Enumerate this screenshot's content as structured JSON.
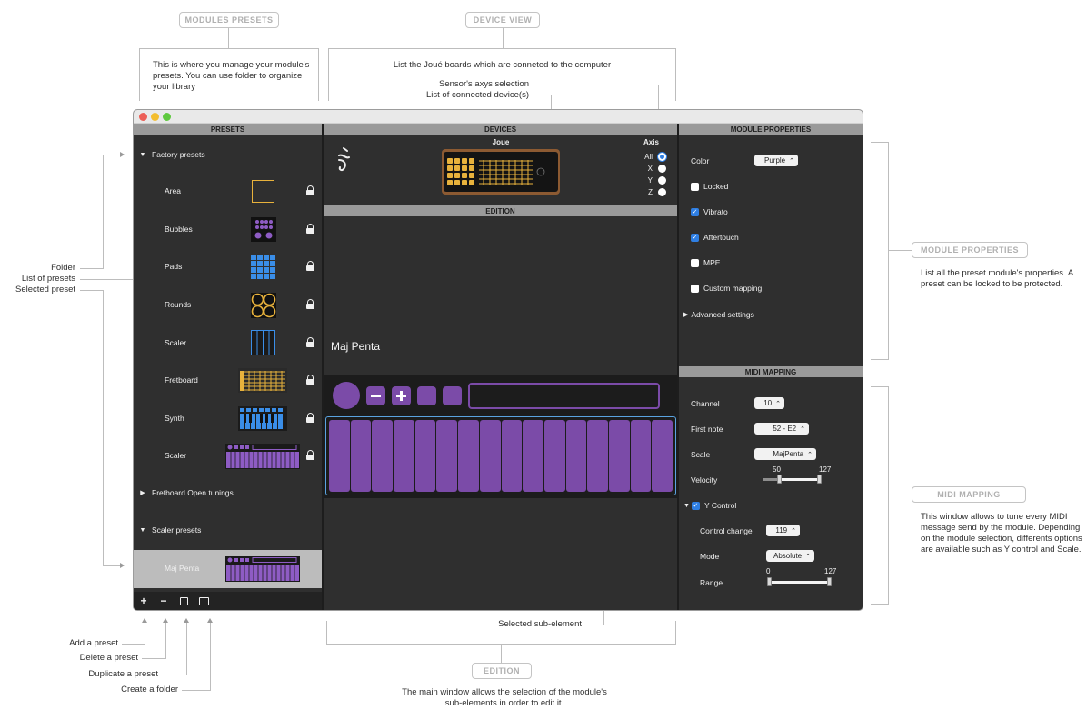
{
  "annotations": {
    "modules_presets": {
      "title": "MODULES PRESETS",
      "text": "This is where you manage your module's presets. You can use folder to organize your library"
    },
    "device_view": {
      "title": "DEVICE VIEW",
      "text": "List the Joué boards which are conneted to the computer",
      "sensor_axis": "Sensor's axys selection",
      "connected_devices": "List of connected device(s)"
    },
    "left": {
      "folder": "Folder",
      "list_of_presets": "List of presets",
      "selected_preset": "Selected preset"
    },
    "module_properties": {
      "title": "MODULE PROPERTIES",
      "text": "List all the preset module's properties. A preset can be locked to be protected."
    },
    "midi_mapping": {
      "title": "MIDI MAPPING",
      "text": "This window allows to tune every MIDI message send by the module. Depending on the module selection, differents options are available such as Y control and Scale."
    },
    "bottom": {
      "add_preset": "Add a preset",
      "delete_preset": "Delete a preset",
      "duplicate_preset": "Duplicate a preset",
      "create_folder": "Create a folder",
      "selected_sub_element": "Selected sub-element"
    },
    "edition": {
      "title": "EDITION",
      "text": "The main window allows the selection of the module's sub-elements in order to edit it."
    }
  },
  "app": {
    "presets_header": "PRESETS",
    "devices_header": "DEVICES",
    "edition_header": "EDITION",
    "module_properties_header": "MODULE PROPERTIES",
    "midi_mapping_header": "MIDI MAPPING",
    "presets": {
      "factory_folder": "Factory presets",
      "factory_items": [
        "Area",
        "Bubbles",
        "Pads",
        "Rounds",
        "Scaler",
        "Fretboard",
        "Synth",
        "Scaler"
      ],
      "fretboard_folder": "Fretboard Open tunings",
      "scaler_folder": "Scaler presets",
      "selected_item": "Maj Penta",
      "buttons": {
        "add": "+",
        "delete": "−"
      }
    },
    "devices": {
      "device_name": "Joue",
      "axis_label": "Axis",
      "axes": [
        "All",
        "X",
        "Y",
        "Z"
      ],
      "selected_axis": "All"
    },
    "edition": {
      "preset_title": "Maj Penta",
      "pads": 16
    },
    "properties": {
      "color_label": "Color",
      "color_value": "Purple",
      "locked": "Locked",
      "vibrato": "Vibrato",
      "aftertouch": "Aftertouch",
      "mpe": "MPE",
      "custom_mapping": "Custom mapping",
      "advanced": "Advanced settings"
    },
    "midi": {
      "channel_label": "Channel",
      "channel_value": "10",
      "first_note_label": "First note",
      "first_note_value": "52 - E2",
      "scale_label": "Scale",
      "scale_value": "MajPenta",
      "velocity_label": "Velocity",
      "velocity_min": "50",
      "velocity_max": "127",
      "y_control_label": "Y Control",
      "control_change_label": "Control change",
      "control_change_value": "119",
      "mode_label": "Mode",
      "mode_value": "Absolute",
      "range_label": "Range",
      "range_min": "0",
      "range_max": "127"
    }
  },
  "colors": {
    "accent_purple": "#7b4ba8",
    "accent_yellow": "#e8b23c",
    "accent_blue": "#2f7fe3",
    "selection_blue": "#5aa3e0"
  }
}
